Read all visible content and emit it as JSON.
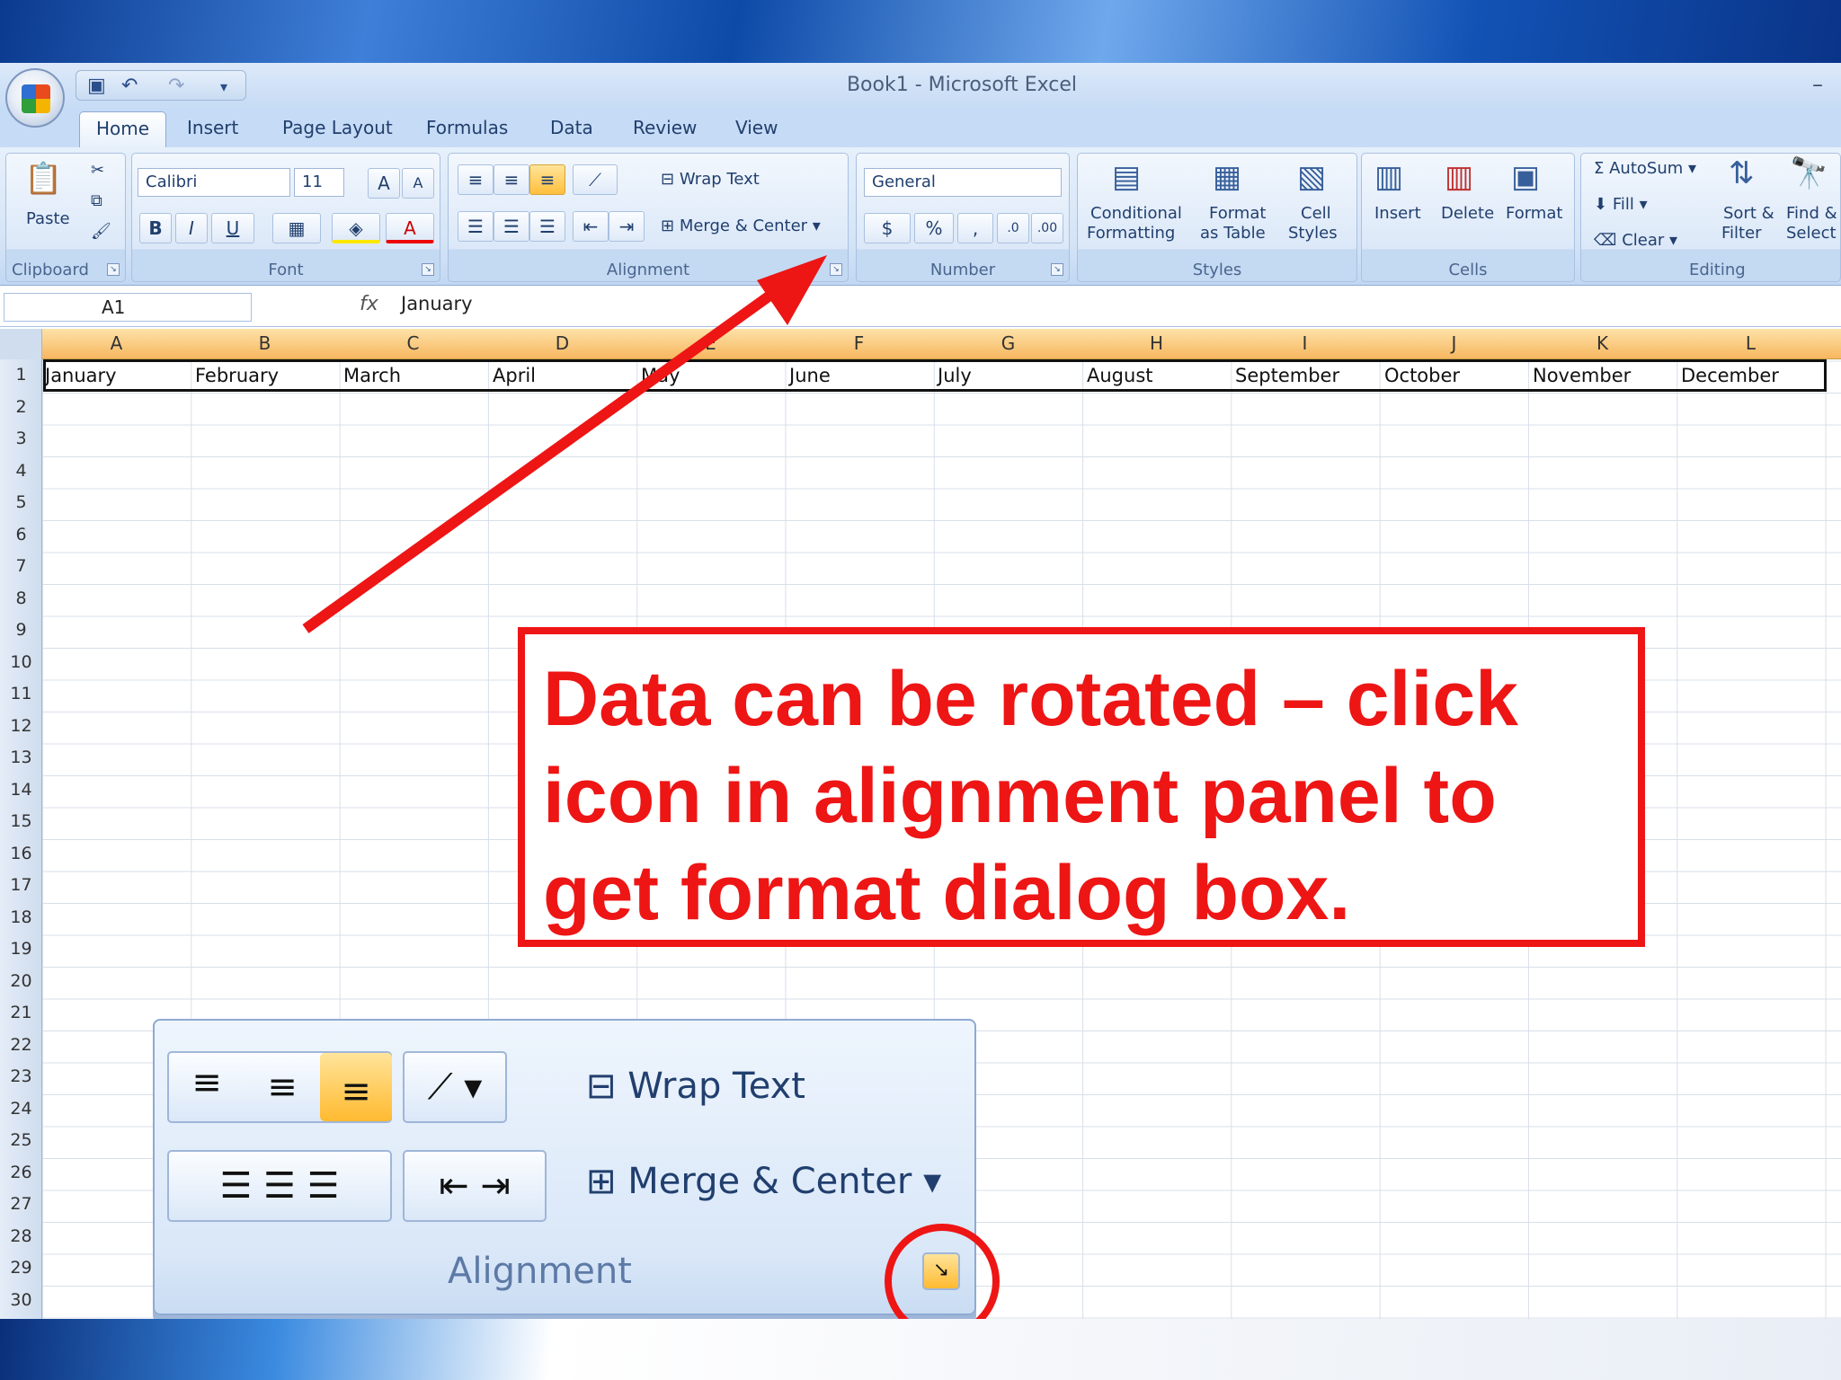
{
  "window": {
    "title": "Book1 - Microsoft Excel"
  },
  "tabs": [
    "Home",
    "Insert",
    "Page Layout",
    "Formulas",
    "Data",
    "Review",
    "View"
  ],
  "ribbon": {
    "clipboard": {
      "label": "Clipboard",
      "paste": "Paste"
    },
    "font": {
      "label": "Font",
      "name": "Calibri",
      "size": "11"
    },
    "alignment": {
      "label": "Alignment",
      "wrap": "Wrap Text",
      "merge": "Merge & Center"
    },
    "number": {
      "label": "Number",
      "format": "General"
    },
    "styles": {
      "label": "Styles",
      "cond1": "Conditional",
      "cond2": "Formatting",
      "fmt1": "Format",
      "fmt2": "as Table",
      "cell1": "Cell",
      "cell2": "Styles"
    },
    "cells": {
      "label": "Cells",
      "insert": "Insert",
      "delete": "Delete",
      "format": "Format"
    },
    "editing": {
      "label": "Editing",
      "autosum": "AutoSum",
      "fill": "Fill",
      "clear": "Clear",
      "sort1": "Sort &",
      "sort2": "Filter",
      "find1": "Find &",
      "find2": "Select"
    }
  },
  "formula_bar": {
    "name_box": "A1",
    "value": "January"
  },
  "columns": [
    "A",
    "B",
    "C",
    "D",
    "E",
    "F",
    "G",
    "H",
    "I",
    "J",
    "K",
    "L"
  ],
  "row1": [
    "January",
    "February",
    "March",
    "April",
    "May",
    "June",
    "July",
    "August",
    "September",
    "October",
    "November",
    "December"
  ],
  "callout": {
    "text": "Data can be rotated – click icon in alignment panel to get format dialog box."
  },
  "zoom_panel": {
    "wrap": "Wrap Text",
    "merge": "Merge & Center",
    "label": "Alignment"
  },
  "colors": {
    "accent": "#ee1515",
    "header": "#f7b760"
  }
}
